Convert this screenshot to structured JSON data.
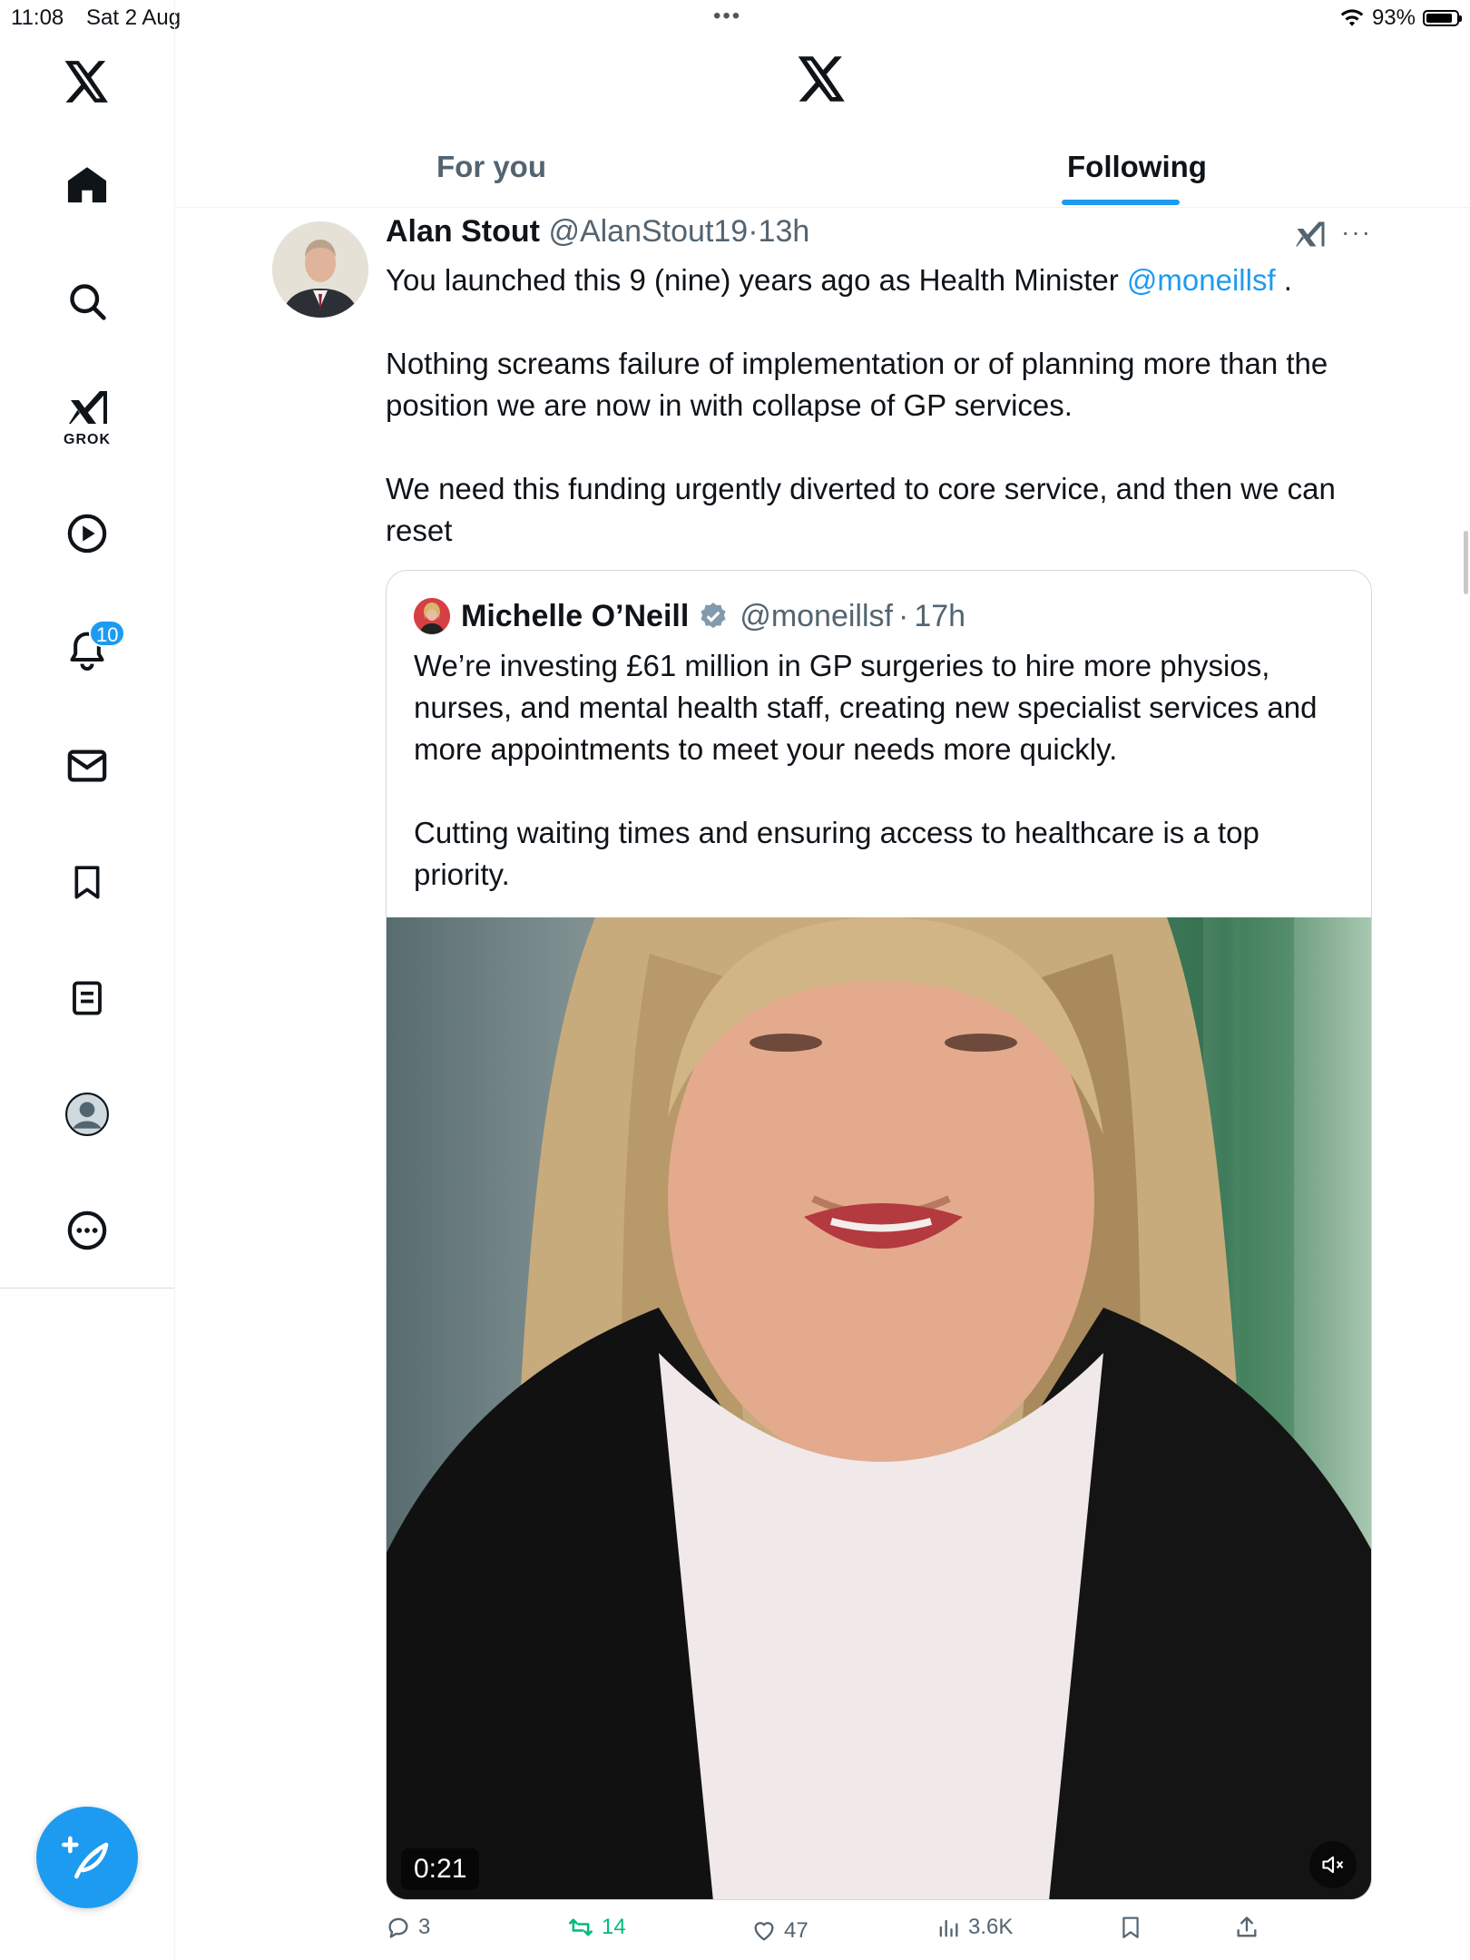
{
  "status_bar": {
    "time": "11:08",
    "date": "Sat 2 Aug",
    "battery": "93%"
  },
  "sidebar": {
    "grok_label": "GROK",
    "notifications_badge": "10",
    "items": [
      "home-icon",
      "search-icon",
      "grok-icon",
      "video-icon",
      "notifications-icon",
      "messages-icon",
      "bookmarks-icon",
      "lists-icon",
      "profile-icon",
      "more-icon"
    ]
  },
  "tabs": [
    {
      "label": "For you",
      "active": false
    },
    {
      "label": "Following",
      "active": true
    }
  ],
  "tweet": {
    "name": "Alan Stout",
    "handle": "@AlanStout19",
    "separator": "·",
    "time": "13h",
    "text_line1": "You launched this 9 (nine) years ago as Health Minister ",
    "mention": "@moneillsf",
    "text_line1_end": " .",
    "paragraph2": "Nothing screams failure of implementation or of planning more than the position we are now in with collapse of GP services.",
    "paragraph3": "We need this funding urgently diverted to core service, and then we can reset",
    "quote": {
      "name": "Michelle O’Neill",
      "handle": "@moneillsf",
      "separator": "·",
      "time": "17h",
      "paragraph1": "We’re investing £61 million in GP surgeries to hire more physios, nurses, and mental health staff, creating new specialist services and more appointments to meet your needs more quickly.",
      "paragraph2": "Cutting waiting times and ensuring access to healthcare is a top priority.",
      "video_duration": "0:21"
    },
    "actions": {
      "replies": "3",
      "reposts": "14",
      "likes": "47",
      "views": "3.6K"
    }
  },
  "colors": {
    "accent": "#1d9bf0",
    "repost_green": "#00ba7c",
    "muted_text": "#536471"
  }
}
